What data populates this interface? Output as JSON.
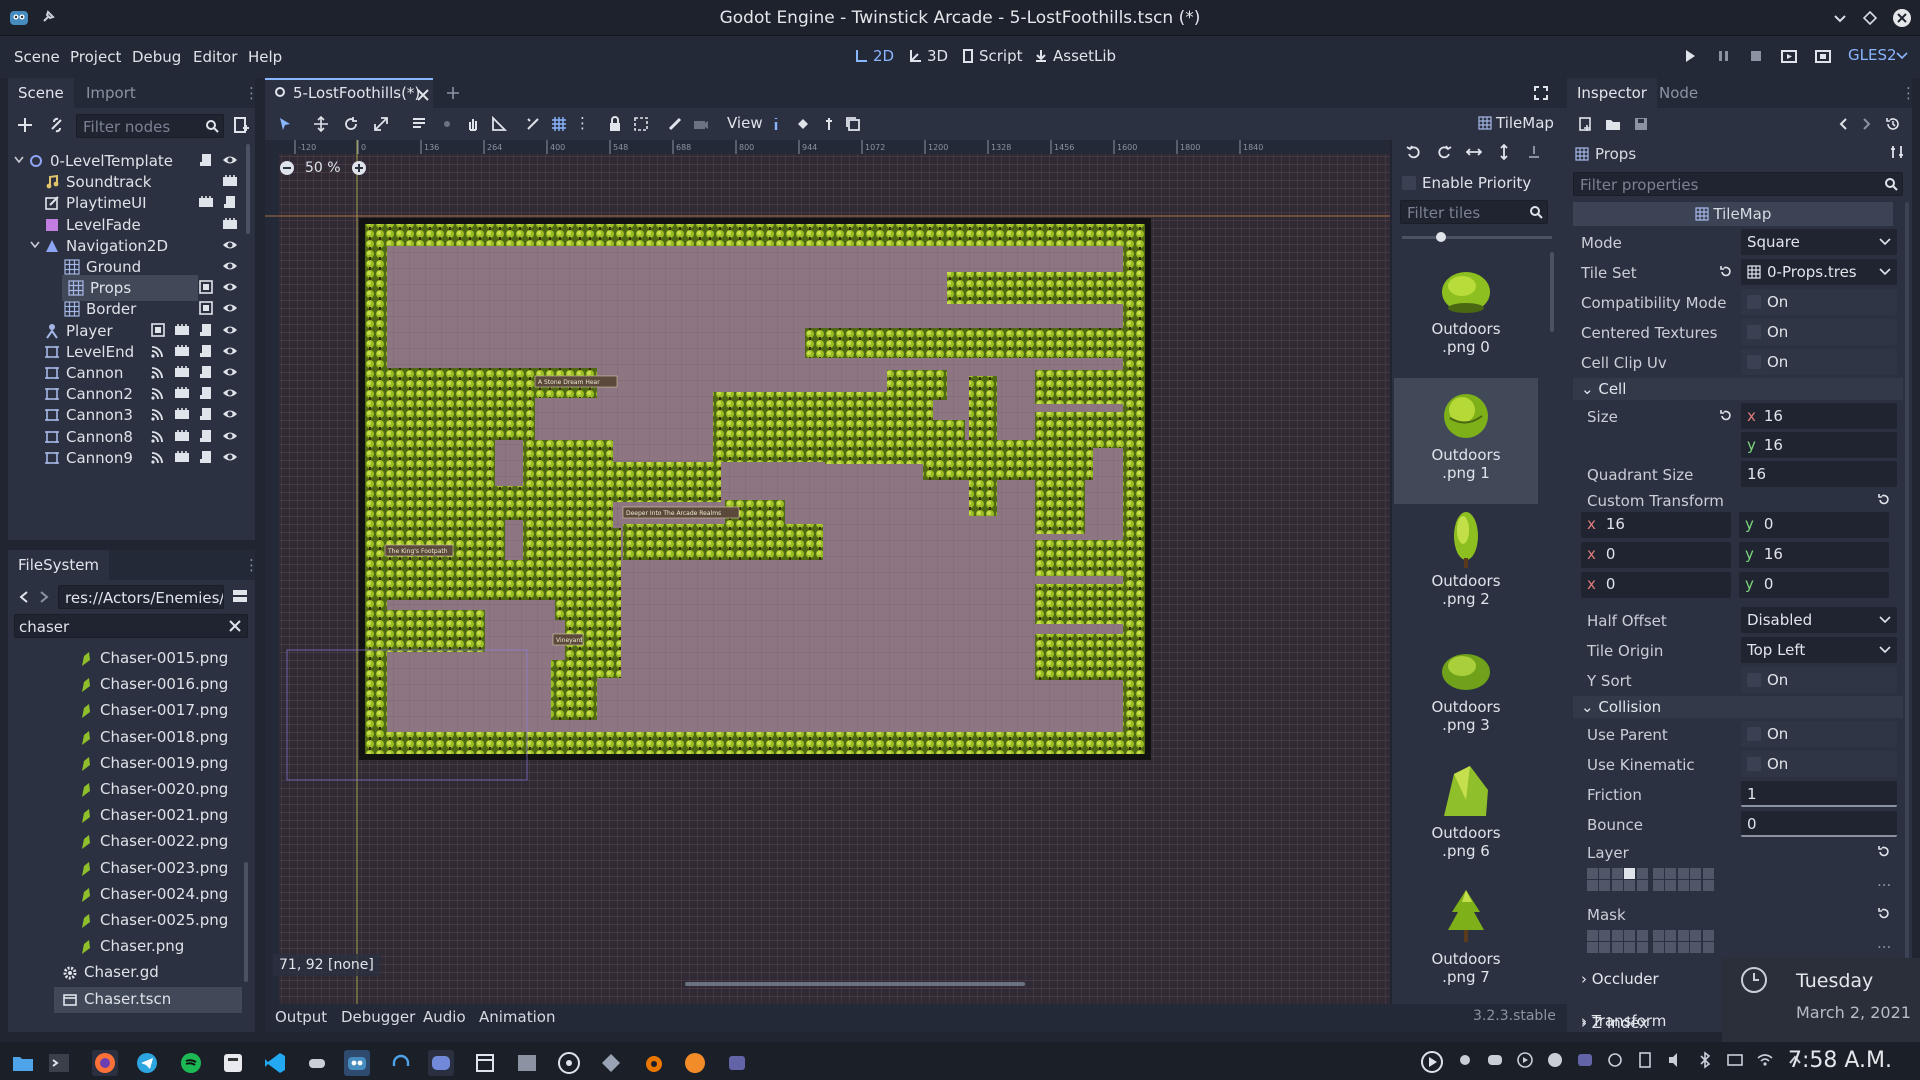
{
  "window": {
    "title": "Godot Engine - Twinstick Arcade - 5-LostFoothills.tscn (*)"
  },
  "menu": [
    "Scene",
    "Project",
    "Debug",
    "Editor",
    "Help"
  ],
  "workspaces": {
    "w2d": "2D",
    "w3d": "3D",
    "script": "Script",
    "assetlib": "AssetLib"
  },
  "renderer": "GLES2",
  "scene_dock": {
    "tabs": [
      "Scene",
      "Import"
    ],
    "filter_placeholder": "Filter nodes",
    "nodes": [
      {
        "name": "0-LevelTemplate"
      },
      {
        "name": "Soundtrack"
      },
      {
        "name": "PlaytimeUI"
      },
      {
        "name": "LevelFade"
      },
      {
        "name": "Navigation2D"
      },
      {
        "name": "Ground"
      },
      {
        "name": "Props"
      },
      {
        "name": "Border"
      },
      {
        "name": "Player"
      },
      {
        "name": "LevelEnd"
      },
      {
        "name": "Cannon"
      },
      {
        "name": "Cannon2"
      },
      {
        "name": "Cannon3"
      },
      {
        "name": "Cannon8"
      },
      {
        "name": "Cannon9"
      }
    ]
  },
  "filesystem": {
    "tab": "FileSystem",
    "path": "res://Actors/Enemies/C",
    "search": "chaser",
    "files": [
      "Chaser-0015.png",
      "Chaser-0016.png",
      "Chaser-0017.png",
      "Chaser-0018.png",
      "Chaser-0019.png",
      "Chaser-0020.png",
      "Chaser-0021.png",
      "Chaser-0022.png",
      "Chaser-0023.png",
      "Chaser-0024.png",
      "Chaser-0025.png",
      "Chaser.png",
      "Chaser.gd",
      "Chaser.tscn"
    ]
  },
  "editor": {
    "scene_tab": "5-LostFoothills(*)",
    "view_menu": "View",
    "zoom": "50 %",
    "cursor_readout": "71, 92 [none]",
    "ruler_labels": [
      "-120",
      "0",
      "136",
      "264",
      "400",
      "548",
      "688",
      "800",
      "944",
      "1072",
      "1200",
      "1328",
      "1456",
      "1600",
      "1800",
      "1840"
    ],
    "map_labels": [
      "A Stone Dream Hear",
      "Deeper Into The Arcade Realms",
      "The King's Footpath",
      "Vineyard"
    ]
  },
  "tilemap_panel": {
    "tab": "TileMap",
    "enable_priority": "Enable Priority",
    "filter_placeholder": "Filter tiles",
    "tiles": [
      {
        "name": "Outdoors",
        "sub": ".png 0"
      },
      {
        "name": "Outdoors",
        "sub": ".png 1"
      },
      {
        "name": "Outdoors",
        "sub": ".png 2"
      },
      {
        "name": "Outdoors",
        "sub": ".png 3"
      },
      {
        "name": "Outdoors",
        "sub": ".png 6"
      },
      {
        "name": "Outdoors",
        "sub": ".png 7"
      }
    ]
  },
  "inspector": {
    "tabs": [
      "Inspector",
      "Node"
    ],
    "object": "Props",
    "filter_placeholder": "Filter properties",
    "class_header": "TileMap",
    "mode_label": "Mode",
    "mode": "Square",
    "tileset_label": "Tile Set",
    "tileset": "0-Props.tres",
    "compat_label": "Compatibility Mode",
    "centered_label": "Centered Textures",
    "clipuv_label": "Cell Clip Uv",
    "on": "On",
    "cell_section": "Cell",
    "size_label": "Size",
    "size_x": "16",
    "size_y": "16",
    "quadrant_label": "Quadrant Size",
    "quadrant": "16",
    "custom_transform_label": "Custom Transform",
    "transform": [
      [
        "16",
        "0"
      ],
      [
        "0",
        "16"
      ],
      [
        "0",
        "0"
      ]
    ],
    "half_offset_label": "Half Offset",
    "half_offset": "Disabled",
    "tile_origin_label": "Tile Origin",
    "tile_origin": "Top Left",
    "ysort_label": "Y Sort",
    "collision_section": "Collision",
    "use_parent_label": "Use Parent",
    "use_kinematic_label": "Use Kinematic",
    "friction_label": "Friction",
    "friction": "1",
    "bounce_label": "Bounce",
    "bounce": "0",
    "layer_label": "Layer",
    "mask_label": "Mask",
    "occluder_section": "Occluder",
    "transform_section": "Transform",
    "zindex_section": "Z Index",
    "ellipsis": "..."
  },
  "bottom_panel": {
    "tabs": [
      "Output",
      "Debugger",
      "Audio",
      "Animation"
    ],
    "version": "3.2.3.stable"
  },
  "notification": {
    "day": "Tuesday",
    "date": "March 2, 2021"
  },
  "taskbar": {
    "time": "7:58 A.M."
  },
  "colors": {
    "accent": "#8ab5ff",
    "panel": "#2b3140",
    "bg": "#202531",
    "grass": "#7fa11a",
    "grid": "#6e5361"
  }
}
